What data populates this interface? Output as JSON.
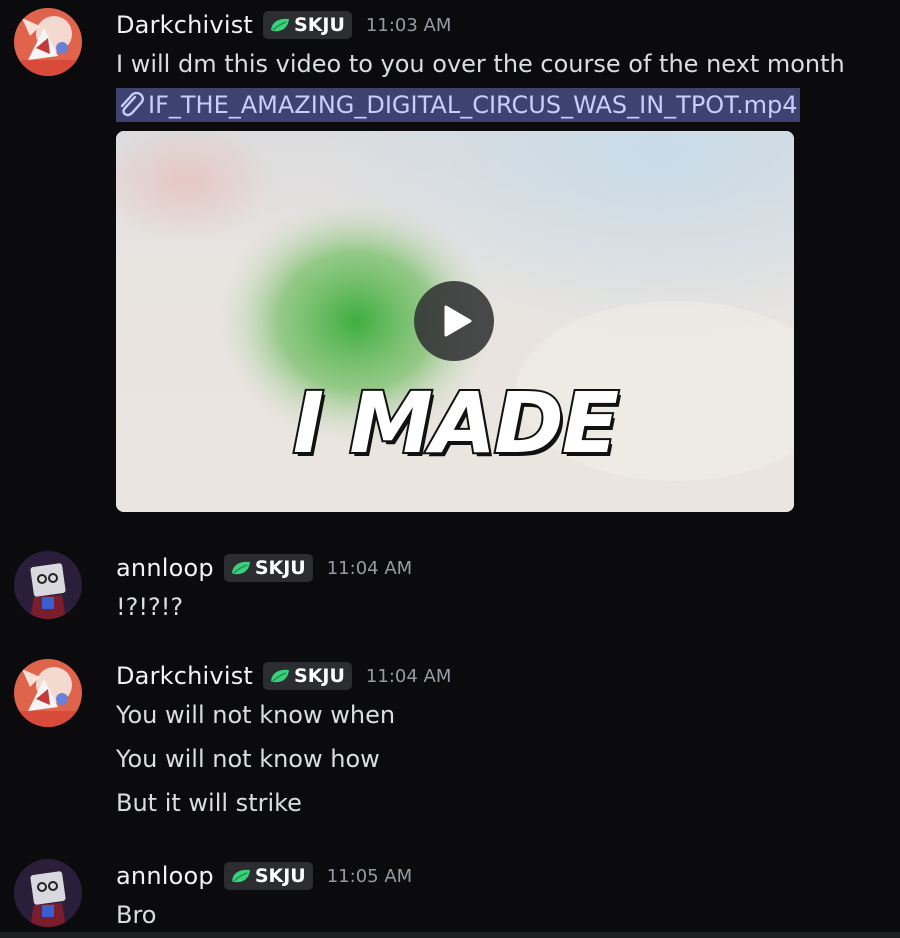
{
  "messages": [
    {
      "username": "Darkchivist",
      "tag": "SKJU",
      "time": "11:03 AM",
      "lines": [
        "I will dm this video to you over the course of the next month"
      ],
      "attachment": {
        "filename": "IF_THE_AMAZING_DIGITAL_CIRCUS_WAS_IN_TPOT.mp4",
        "thumbnail_text": "I MADE"
      }
    },
    {
      "username": "annloop",
      "tag": "SKJU",
      "time": "11:04 AM",
      "lines": [
        "!?!?!?"
      ]
    },
    {
      "username": "Darkchivist",
      "tag": "SKJU",
      "time": "11:04 AM",
      "lines": [
        "You will not know when",
        "You will not know how",
        "But it will strike"
      ]
    },
    {
      "username": "annloop",
      "tag": "SKJU",
      "time": "11:05 AM",
      "lines": [
        "Bro"
      ]
    }
  ],
  "colors": {
    "background": "#0b0b0d",
    "tag_background": "#2b2d31",
    "tag_leaf": "#3ad17c",
    "attachment_highlight": "#3d4270",
    "timestamp": "#949ba4"
  },
  "icons": {
    "tag": "leaf-icon",
    "attachment": "paperclip-icon",
    "video": "play-icon"
  }
}
